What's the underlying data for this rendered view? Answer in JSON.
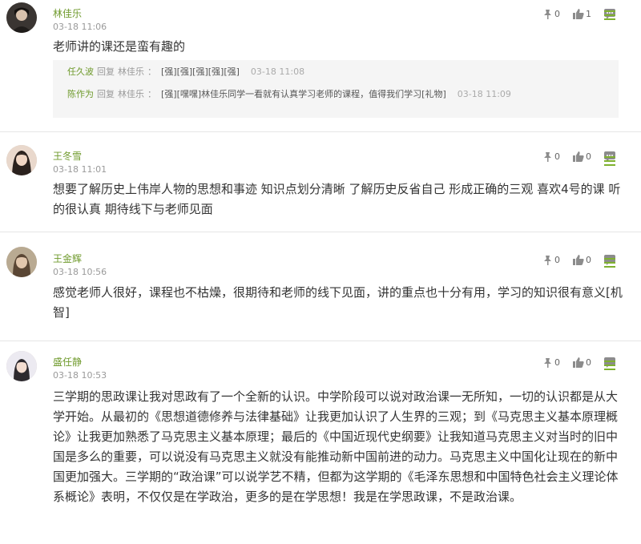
{
  "comments": [
    {
      "user": "林佳乐",
      "time": "03-18 11:06",
      "text": "老师讲的课还是蛮有趣的",
      "dislikes": "0",
      "likes": "1",
      "replies": [
        {
          "user": "任久波",
          "verb": "回复",
          "target": "林佳乐",
          "sep": "：",
          "text": "[强][强][强][强][强]",
          "time": "03-18 11:08"
        },
        {
          "user": "陈作为",
          "verb": "回复",
          "target": "林佳乐",
          "sep": "：",
          "text": "[强][嘿嘿]林佳乐同学一看就有认真学习老师的课程，值得我们学习[礼物]",
          "time": "03-18 11:09"
        }
      ]
    },
    {
      "user": "王冬雪",
      "time": "03-18 11:01",
      "text": "想要了解历史上伟岸人物的思想和事迹 知识点划分清晰 了解历史反省自己 形成正确的三观 喜欢4号的课 听的很认真 期待线下与老师见面",
      "dislikes": "0",
      "likes": "0"
    },
    {
      "user": "王金辉",
      "time": "03-18 10:56",
      "text": "感觉老师人很好，课程也不枯燥，很期待和老师的线下见面，讲的重点也十分有用，学习的知识很有意义[机智]",
      "dislikes": "0",
      "likes": "0"
    },
    {
      "user": "盛任静",
      "time": "03-18 10:53",
      "text": "三学期的思政课让我对思政有了一个全新的认识。中学阶段可以说对政治课一无所知，一切的认识都是从大学开始。从最初的《思想道德修养与法律基础》让我更加认识了人生界的三观；到《马克思主义基本原理概论》让我更加熟悉了马克思主义基本原理；最后的《中国近现代史纲要》让我知道马克思主义对当时的旧中国是多么的重要，可以说没有马克思主义就没有能推动新中国前进的动力。马克思主义中国化让现在的新中国更加强大。三学期的“政治课”可以说学艺不精，但都为这学期的《毛泽东思想和中国特色社会主义理论体系概论》表明，不仅仅是在学政治，更多的是在学思想！我是在学思政课，不是政治课。",
      "dislikes": "0",
      "likes": "0"
    }
  ],
  "icons": {
    "dislike": "thumbs-down-pin-icon",
    "like": "thumbs-up-icon",
    "reply": "speech-bubble-icon",
    "menu": "menu-icon"
  },
  "colors": {
    "username": "#6f9a2c",
    "menu": "#7fb12f",
    "reply_bg": "#f5f5f5"
  }
}
